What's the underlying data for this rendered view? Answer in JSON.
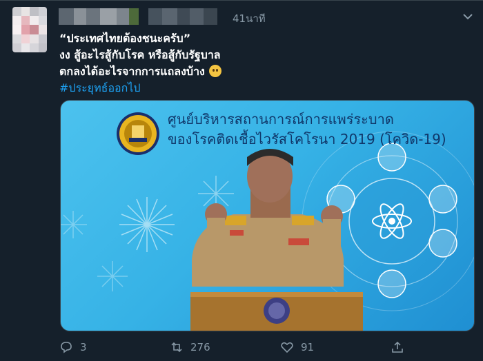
{
  "tweet": {
    "time": "41นาที",
    "lines": [
      "“ประเทศไทยต้องชนะครับ”",
      "งง สู้อะไรสู้กับโรค หรือสู้กับรัฐบาล",
      "ตกลงได้อะไรจากการแถลงบ้าง"
    ],
    "hashtag": "#ประยุทธ์ออกไป"
  },
  "media": {
    "headline_line1": "ศูนย์บริหารสถานการณ์การแพร่ระบาด",
    "headline_line2": "ของโรคติดเชื้อไวรัสโคโรนา 2019 (โควิด-19)"
  },
  "actions": {
    "reply_count": "3",
    "retweet_count": "276",
    "like_count": "91"
  },
  "colors": {
    "background": "#15202b",
    "muted": "#8899a6",
    "link": "#1da1f2",
    "media_blue": "#36b2e6",
    "headline": "#10386b"
  },
  "icons": [
    "reply-icon",
    "retweet-icon",
    "like-icon",
    "share-icon",
    "chevron-down-icon",
    "emoji-icon",
    "emblem-icon",
    "atom-icon"
  ]
}
